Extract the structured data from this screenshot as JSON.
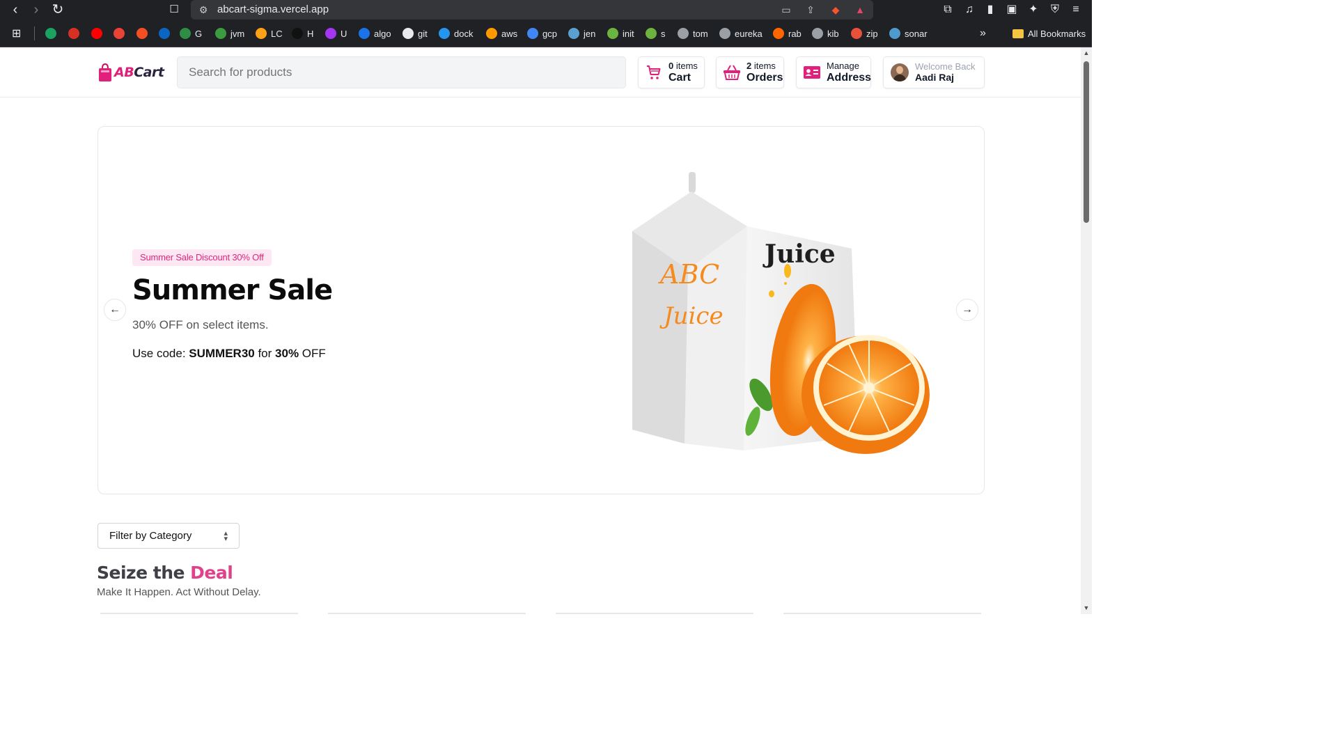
{
  "browser": {
    "url": "abcart-sigma.vercel.app",
    "bookmarks": [
      {
        "label": "",
        "icon": "cb-icon",
        "color": "#1aa260"
      },
      {
        "label": "",
        "icon": "diamond-icon",
        "color": "#d93025"
      },
      {
        "label": "",
        "icon": "youtube-icon",
        "color": "#ff0000"
      },
      {
        "label": "",
        "icon": "gmail-icon",
        "color": "#ea4335"
      },
      {
        "label": "",
        "icon": "microsoft-icon",
        "color": "#f25022"
      },
      {
        "label": "",
        "icon": "linkedin-icon",
        "color": "#0a66c2"
      },
      {
        "label": "G",
        "icon": "gfg-icon",
        "color": "#2f8d46"
      },
      {
        "label": "jvm",
        "icon": "jvm-icon",
        "color": "#3c9a3f"
      },
      {
        "label": "LC",
        "icon": "leetcode-icon",
        "color": "#ffa116"
      },
      {
        "label": "H",
        "icon": "hackerrank-icon",
        "color": "#111"
      },
      {
        "label": "U",
        "icon": "udemy-icon",
        "color": "#a435f0"
      },
      {
        "label": "algo",
        "icon": "algo-icon",
        "color": "#1a73e8"
      },
      {
        "label": "git",
        "icon": "github-icon",
        "color": "#e8eaed"
      },
      {
        "label": "dock",
        "icon": "docker-icon",
        "color": "#2496ed"
      },
      {
        "label": "aws",
        "icon": "aws-icon",
        "color": "#ff9900"
      },
      {
        "label": "gcp",
        "icon": "google-icon",
        "color": "#4285f4"
      },
      {
        "label": "jen",
        "icon": "jenkins-icon",
        "color": "#5aa0d0"
      },
      {
        "label": "init",
        "icon": "spring-icon",
        "color": "#6db33f"
      },
      {
        "label": "s",
        "icon": "spring-icon",
        "color": "#6db33f"
      },
      {
        "label": "tom",
        "icon": "globe-icon",
        "color": "#9aa0a6"
      },
      {
        "label": "eureka",
        "icon": "globe-icon",
        "color": "#9aa0a6"
      },
      {
        "label": "rab",
        "icon": "rabbitmq-icon",
        "color": "#ff6600"
      },
      {
        "label": "kib",
        "icon": "kibana-icon",
        "color": "#9aa0a6"
      },
      {
        "label": "zip",
        "icon": "zipkin-icon",
        "color": "#e8513a"
      },
      {
        "label": "sonar",
        "icon": "sonar-icon",
        "color": "#4e9bcd"
      }
    ],
    "all_bookmarks_label": "All Bookmarks"
  },
  "header": {
    "logo_ab": "AB",
    "logo_cart": "Cart",
    "search_placeholder": "Search for products",
    "cart": {
      "count": "0",
      "count_suffix": " items",
      "label": "Cart"
    },
    "orders": {
      "count": "2",
      "count_suffix": " items",
      "label": "Orders"
    },
    "address": {
      "small": "Manage",
      "label": "Address"
    },
    "user": {
      "greeting": "Welcome Back",
      "name": "Aadi Raj"
    }
  },
  "hero": {
    "badge": "Summer Sale Discount 30% Off",
    "title": "Summer Sale",
    "subtitle": "30% OFF on select items.",
    "code_prefix": "Use code: ",
    "code": "SUMMER30",
    "code_mid": " for ",
    "code_pct": "30%",
    "code_suffix": " OFF",
    "image_text_1": "ABC",
    "image_text_2": "Juice",
    "image_text_3": "Juice"
  },
  "filter": {
    "label": "Filter by Category"
  },
  "section": {
    "title_prefix": "Seize the ",
    "title_accent": "Deal",
    "subtitle": "Make It Happen. Act Without Delay."
  },
  "colors": {
    "brand_pink": "#e0207a",
    "accent_orange": "#f58a1f"
  }
}
